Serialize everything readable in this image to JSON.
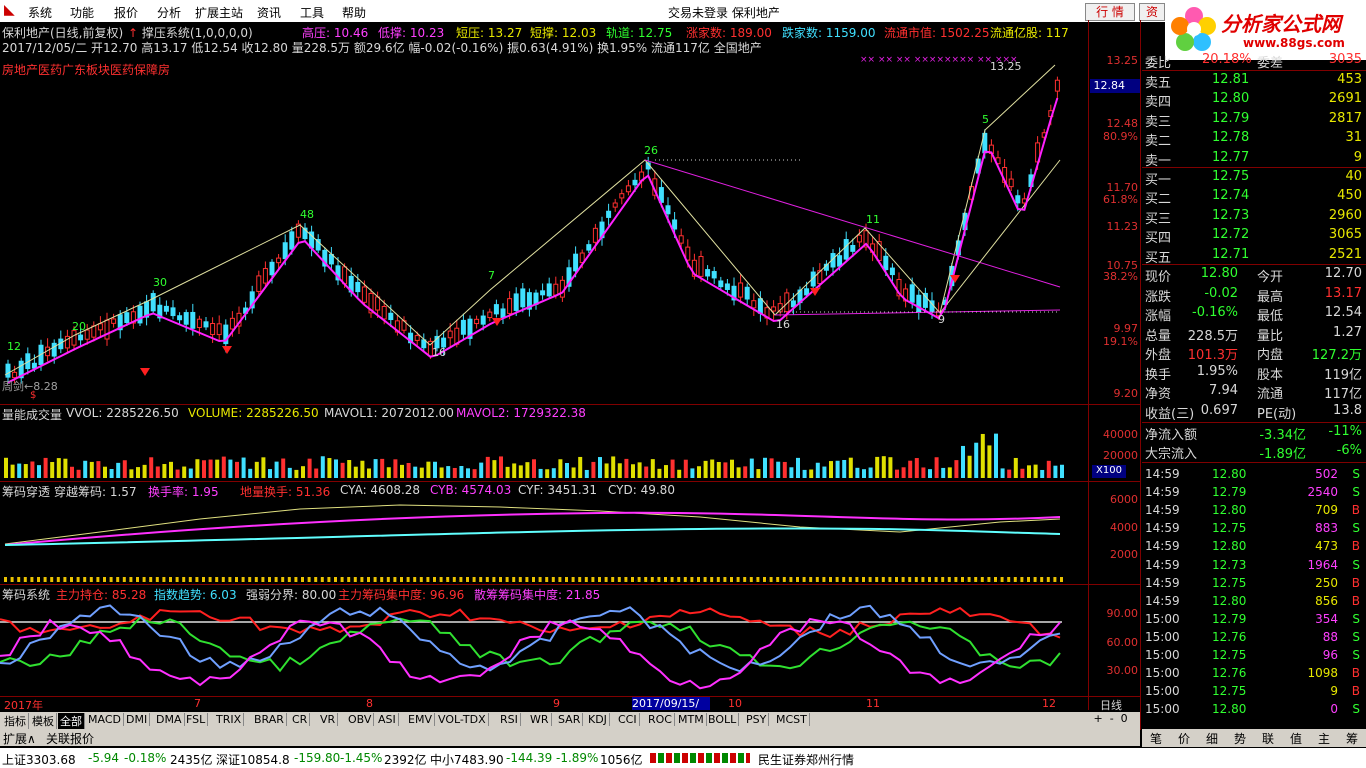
{
  "menu": {
    "items": [
      "系统",
      "功能",
      "报价",
      "分析",
      "扩展主站",
      "资讯",
      "工具",
      "帮助"
    ],
    "center": "交易未登录  保利地产",
    "btn_trade": "行 情",
    "btn_info": "资",
    "logo": "分析家公式网",
    "logo_url": "www.88gs.com"
  },
  "header": {
    "stock": "保利地产(日线,前复权)",
    "indicator": "撑压系统(1,0,0,0,0)",
    "gaoya": "高压: 10.46",
    "diya": "低撑: 10.23",
    "duanya": "短压: 13.27",
    "duancheng": "短撑: 12.03",
    "guidao": "轨道: 12.75",
    "up_count": "涨家数: 189.00",
    "down_count": "跌家数: 1159.00",
    "float_val": "流通市值: 1502.25",
    "float_cap": "流通亿股: 117",
    "ohlc": "2017/12/05/二 开12.70 高13.17 低12.54 收12.80 量228.5万 额29.6亿 幅-0.02(-0.16%) 振0.63(4.91%) 换1.95% 流通117亿 全国地产",
    "sector": "房地产医药广东板块医药保障房"
  },
  "chart_labels": {
    "n12": "12",
    "n20": "20",
    "n30": "30",
    "n48": "48",
    "n16a": "16",
    "n7": "7",
    "n26": "26",
    "n16b": "16",
    "n11": "11",
    "n9": "9",
    "n5": "5",
    "n1325": "13.25",
    "tri": "周剑←8.28"
  },
  "price_axis": [
    "13.25",
    "12.84",
    "12.48",
    "80.9%",
    "11.70",
    "61.8%",
    "11.23",
    "10.75",
    "38.2%",
    "9.97",
    "19.1%",
    "9.20"
  ],
  "vol_header": {
    "name": "量能成交量",
    "vvol": "VVOL: 2285226.50",
    "volume": "VOLUME: 2285226.50",
    "mavol1": "MAVOL1: 2072012.00",
    "mavol2": "MAVOL2: 1729322.38",
    "axis": [
      "40000",
      "20000",
      "X100"
    ]
  },
  "chip_header": {
    "name": "筹码穿透",
    "cross": "穿越筹码: 1.57",
    "turn": "换手率: 1.95",
    "turn_vol": "地量换手: 51.36",
    "cya": "CYA: 4608.28",
    "cyb": "CYB: 4574.03",
    "cyf": "CYF: 3451.31",
    "cyd": "CYD: 49.80",
    "axis": [
      "6000",
      "4000",
      "2000"
    ]
  },
  "sys_header": {
    "name": "筹码系统",
    "main": "主力持仓: 85.28",
    "index": "指数趋势: 6.03",
    "bound": "强弱分界: 80.00",
    "conc": "主力筹码集中度: 96.96",
    "scatter": "散筹筹码集中度: 21.85",
    "axis": [
      "90.00",
      "60.00",
      "30.00"
    ]
  },
  "xaxis": {
    "year": "2017年",
    "m7": "7",
    "m8": "8",
    "m9": "9",
    "sel": "2017/09/15/五",
    "m10": "10",
    "m11": "11",
    "m12": "12",
    "daily": "日线"
  },
  "tabs": [
    "指标",
    "模板",
    "全部",
    "MACD",
    "DMI",
    "DMA",
    "FSL",
    "TRIX",
    "BRAR",
    "CR",
    "VR",
    "OBV",
    "ASI",
    "EMV",
    "VOL-TDX",
    "RSI",
    "WR",
    "SAR",
    "KDJ",
    "CCI",
    "ROC",
    "MTM",
    "BOLL",
    "PSY",
    "MCST"
  ],
  "tabs2": [
    "扩展∧",
    "关联报价"
  ],
  "quote": {
    "weibi_l": "委比",
    "weibi": "20.18%",
    "weicha_l": "委差",
    "weicha": "3035",
    "asks": [
      [
        "卖五",
        "12.81",
        "453"
      ],
      [
        "卖四",
        "12.80",
        "2691"
      ],
      [
        "卖三",
        "12.79",
        "2817"
      ],
      [
        "卖二",
        "12.78",
        "31"
      ],
      [
        "卖一",
        "12.77",
        "9"
      ]
    ],
    "bids": [
      [
        "买一",
        "12.75",
        "40"
      ],
      [
        "买二",
        "12.74",
        "450"
      ],
      [
        "买三",
        "12.73",
        "2960"
      ],
      [
        "买四",
        "12.72",
        "3065"
      ],
      [
        "买五",
        "12.71",
        "2521"
      ]
    ],
    "stats": [
      [
        "现价",
        "12.80",
        "今开",
        "12.70"
      ],
      [
        "涨跌",
        "-0.02",
        "最高",
        "13.17"
      ],
      [
        "涨幅",
        "-0.16%",
        "最低",
        "12.54"
      ],
      [
        "总量",
        "228.5万",
        "量比",
        "1.27"
      ],
      [
        "外盘",
        "101.3万",
        "内盘",
        "127.2万"
      ],
      [
        "换手",
        "1.95%",
        "股本",
        "119亿"
      ],
      [
        "净资",
        "7.94",
        "流通",
        "117亿"
      ],
      [
        "收益(三)",
        "0.697",
        "PE(动)",
        "13.8"
      ]
    ],
    "flow": [
      [
        "净流入额",
        "-3.34亿",
        "-11%"
      ],
      [
        "大宗流入",
        "-1.89亿",
        "-6%"
      ]
    ]
  },
  "ticks": [
    [
      "14:59",
      "12.80",
      "502",
      "S"
    ],
    [
      "14:59",
      "12.79",
      "2540",
      "S"
    ],
    [
      "14:59",
      "12.80",
      "709",
      "B"
    ],
    [
      "14:59",
      "12.75",
      "883",
      "S"
    ],
    [
      "14:59",
      "12.80",
      "473",
      "B"
    ],
    [
      "14:59",
      "12.73",
      "1964",
      "S"
    ],
    [
      "14:59",
      "12.75",
      "250",
      "B"
    ],
    [
      "14:59",
      "12.80",
      "856",
      "B"
    ],
    [
      "15:00",
      "12.79",
      "354",
      "S"
    ],
    [
      "15:00",
      "12.76",
      "88",
      "S"
    ],
    [
      "15:00",
      "12.75",
      "96",
      "S"
    ],
    [
      "15:00",
      "12.76",
      "1098",
      "B"
    ],
    [
      "15:00",
      "12.75",
      "9",
      "B"
    ],
    [
      "15:00",
      "12.80",
      "0",
      "S"
    ]
  ],
  "right_tabs": [
    "笔",
    "价",
    "细",
    "势",
    "联",
    "值",
    "主",
    "筹"
  ],
  "status": {
    "sh": "上证3303.68",
    "sh_chg": "-5.94",
    "sh_pct": "-0.18%",
    "sh_amt": "2435亿",
    "sz": "深证10854.8",
    "sz_chg": "-159.80",
    "sz_pct": "-1.45%",
    "sz_amt": "2392亿",
    "zx": "中小7483.90",
    "zx_chg": "-144.39",
    "zx_pct": "-1.89%",
    "zx_amt": "1056亿",
    "broker": "民生证券郑州行情"
  },
  "price_marker": "12.84"
}
